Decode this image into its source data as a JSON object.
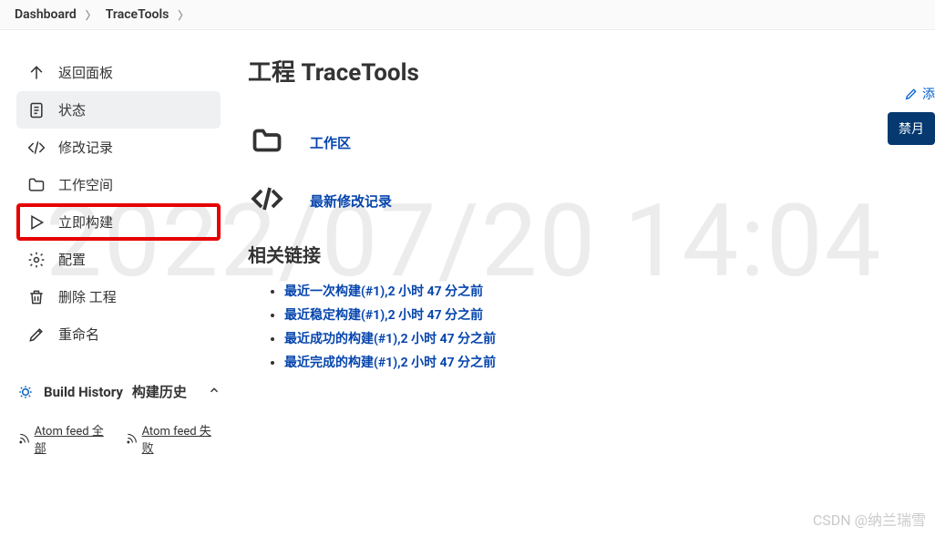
{
  "watermark": "2022/07/20 14:04",
  "csdn_watermark": "CSDN @纳兰瑞雪",
  "breadcrumb": [
    "Dashboard",
    "TraceTools"
  ],
  "sidebar": {
    "items": [
      {
        "label": "返回面板",
        "icon": "arrow-up",
        "active": false,
        "highlighted": false
      },
      {
        "label": "状态",
        "icon": "document",
        "active": true,
        "highlighted": false
      },
      {
        "label": "修改记录",
        "icon": "code",
        "active": false,
        "highlighted": false
      },
      {
        "label": "工作空间",
        "icon": "folder",
        "active": false,
        "highlighted": false
      },
      {
        "label": "立即构建",
        "icon": "play",
        "active": false,
        "highlighted": true
      },
      {
        "label": "配置",
        "icon": "gear",
        "active": false,
        "highlighted": false
      },
      {
        "label": "删除 工程",
        "icon": "trash",
        "active": false,
        "highlighted": false
      },
      {
        "label": "重命名",
        "icon": "pencil",
        "active": false,
        "highlighted": false
      }
    ],
    "build_history": {
      "title": "Build History",
      "subtitle": "构建历史"
    },
    "atom_feeds": [
      {
        "label": "Atom feed 全部"
      },
      {
        "label": "Atom feed 失败"
      }
    ]
  },
  "main": {
    "title": "工程 TraceTools",
    "edit_action": "添",
    "disable_btn": "禁月",
    "workspace_link": "工作区",
    "changes_link": "最新修改记录",
    "section_title": "相关链接",
    "related_links": [
      "最近一次构建(#1),2 小时 47 分之前",
      "最近稳定构建(#1),2 小时 47 分之前",
      "最近成功的构建(#1),2 小时 47 分之前",
      "最近完成的构建(#1),2 小时 47 分之前"
    ]
  }
}
